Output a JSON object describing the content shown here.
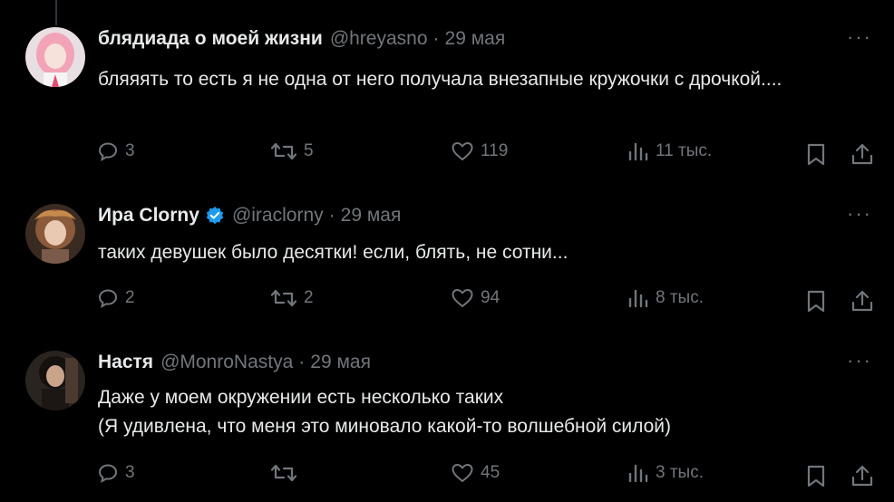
{
  "colors": {
    "background": "#000000",
    "text": "#e7e9ea",
    "muted": "#71767b",
    "verified": "#1d9bf0"
  },
  "tweets": [
    {
      "name": "блядиада о моей жизни",
      "handle": "@hreyasno",
      "separator": "·",
      "date": "29 мая",
      "verified": false,
      "more": "···",
      "text": "бляяять то есть я не одна от него получала внезапные кружочки с дрочкой....",
      "replies": "3",
      "retweets": "5",
      "likes": "119",
      "views": "11 тыс."
    },
    {
      "name": "Ира Clorny",
      "handle": "@iraclorny",
      "separator": "·",
      "date": "29 мая",
      "verified": true,
      "more": "···",
      "text": "таких девушек было десятки! если, блять, не сотни...",
      "replies": "2",
      "retweets": "2",
      "likes": "94",
      "views": "8 тыс."
    },
    {
      "name": "Настя",
      "handle": "@MonroNastya",
      "separator": "·",
      "date": "29 мая",
      "verified": false,
      "more": "···",
      "text_line1": "Даже у моем окружении есть несколько таких",
      "text_line2": "(Я удивлена, что меня это миновало какой-то волшебной силой)",
      "replies": "3",
      "retweets": "",
      "likes": "45",
      "views": "3 тыс."
    }
  ]
}
